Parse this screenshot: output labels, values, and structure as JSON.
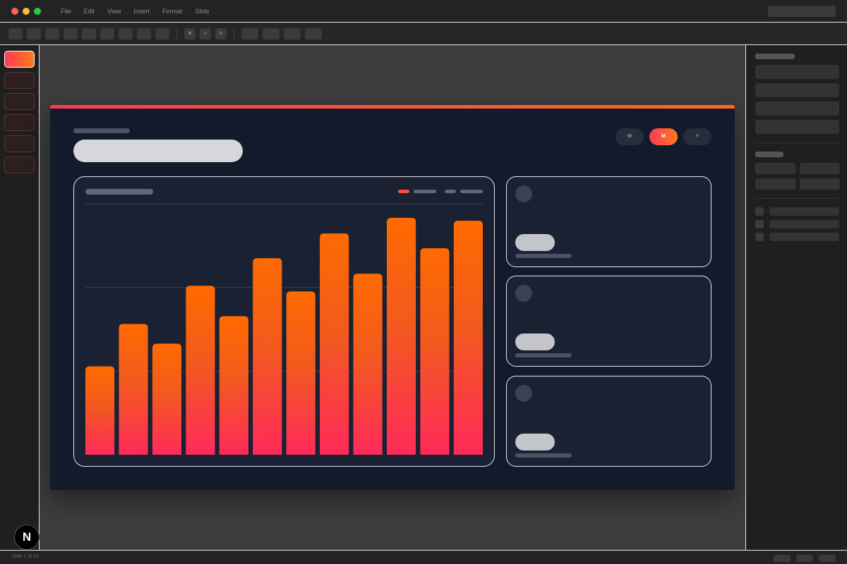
{
  "menu": [
    "File",
    "Edit",
    "View",
    "Insert",
    "Format",
    "Slide"
  ],
  "toolbar": {
    "format_buttons": [
      "B",
      "I",
      "U"
    ]
  },
  "range_selector": {
    "options": [
      "W",
      "M",
      "Y"
    ],
    "selected": "M"
  },
  "colors": {
    "accent_start": "#ff3b57",
    "accent_end": "#ff7a1a",
    "slide_bg": "#131a2b",
    "card_bg": "#1a2133"
  },
  "chart_data": {
    "type": "bar",
    "values": [
      125,
      185,
      157,
      239,
      196,
      278,
      231,
      313,
      256,
      335,
      292,
      331
    ],
    "ylim": [
      0,
      355
    ],
    "grid": true
  },
  "status": {
    "text": "Slide 1 of 24"
  },
  "fab": {
    "label": "N"
  },
  "icons": {
    "fab": "logo-icon",
    "kpi": "circle-icon"
  }
}
